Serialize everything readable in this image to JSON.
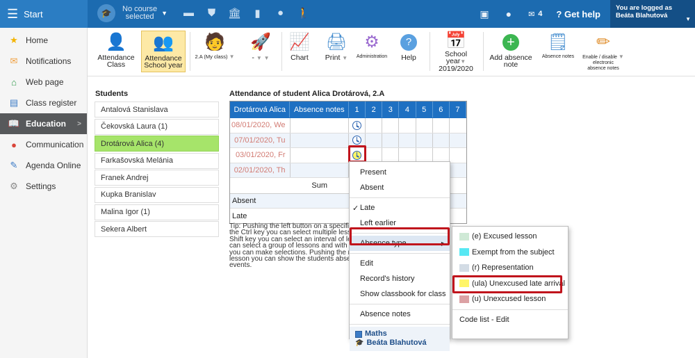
{
  "header": {
    "start_label": "Start",
    "course_line1": "No course",
    "course_line2": "selected",
    "messages_count": "4",
    "help_label": "Get help",
    "logged_line1": "You are logged as",
    "logged_line2": "Beáta Blahutová"
  },
  "sidebar": {
    "items": [
      {
        "label": "Home",
        "icon": "star-icon"
      },
      {
        "label": "Notifications",
        "icon": "envelope-icon"
      },
      {
        "label": "Web page",
        "icon": "house-icon"
      },
      {
        "label": "Class register",
        "icon": "register-icon"
      },
      {
        "label": "Education",
        "icon": "book-icon"
      },
      {
        "label": "Communication",
        "icon": "chat-icon"
      },
      {
        "label": "Agenda Online",
        "icon": "pencil-icon"
      },
      {
        "label": "Settings",
        "icon": "gear-icon"
      }
    ]
  },
  "toolbar": {
    "attendance_class_1": "Attendance",
    "attendance_class_2": "Class",
    "attendance_school_1": "Attendance",
    "attendance_school_2": "School year",
    "class_select": "2.A (My class)",
    "dash_select": "-",
    "chart": "Chart",
    "print": "Print",
    "administration": "Administration",
    "help": "Help",
    "school_year_1": "School year",
    "school_year_2": "2019/2020",
    "add_absence_1": "Add absence",
    "add_absence_2": "note",
    "absence_notes": "Absence notes",
    "enable_1": "Enable / disable",
    "enable_2": "electronic",
    "enable_3": "absence notes"
  },
  "students": {
    "heading": "Students",
    "list": [
      "Antalová Stanislava",
      "Čekovská Laura (1)",
      "Drotárová Alica (4)",
      "Farkašovská Melánia",
      "Franek Andrej",
      "Kupka Branislav",
      "Malina Igor (1)",
      "Sekera Albert"
    ]
  },
  "attendance": {
    "heading": "Attendance of student Alica Drotárová, 2.A",
    "col_student": "Drotárová Alica",
    "col_notes": "Absence notes",
    "lessons": [
      "1",
      "2",
      "3",
      "4",
      "5",
      "6",
      "7"
    ],
    "dates": [
      "08/01/2020, We",
      "07/01/2020, Tu",
      "03/01/2020, Fr",
      "02/01/2020, Th"
    ],
    "sum_label": "Sum",
    "absent_label": "Absent",
    "late_label": "Late"
  },
  "tip": "Tip: Pushing the left button on a specific lesson with the Ctrl key you can select multiple lessons; with the Shift key you can select an interval of lessons. You can select a group of lessons and with the right key you can make selections. Pushing the right key on a lesson you can show the students absence and other events.",
  "context_menu": {
    "present": "Present",
    "absent": "Absent",
    "late": "Late",
    "left_earlier": "Left earlier",
    "absence_type": "Absence type",
    "edit": "Edit",
    "history": "Record's history",
    "classbook": "Show classbook for class",
    "absence_notes": "Absence notes",
    "subject": "Maths",
    "teacher": "Beáta Blahutová"
  },
  "submenu": {
    "items": [
      {
        "label": "(e) Excused lesson",
        "color": "#cfe9d6"
      },
      {
        "label": "Exempt from the subject",
        "color": "#57e8f3"
      },
      {
        "label": "(r) Representation",
        "color": "#d3dce5"
      },
      {
        "label": "(ula) Unexcused late arrival",
        "color": "#fff568"
      },
      {
        "label": "(u) Unexcused lesson",
        "color": "#dca1a4"
      }
    ],
    "code_list": "Code list - Edit"
  },
  "colors": {
    "topbar": "#1c6bb0",
    "highlight": "#c0141c",
    "selected_student": "#a6e46a"
  }
}
